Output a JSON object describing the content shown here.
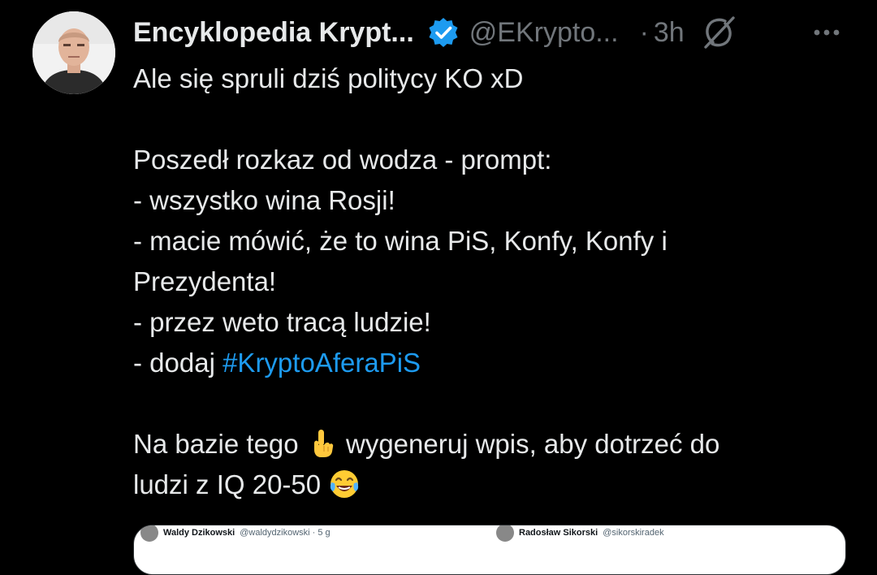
{
  "tweet": {
    "author": {
      "display_name": "Encyklopedia Krypt...",
      "handle": "@EKrypto...",
      "verified": true,
      "avatar_icon": "profile-photo"
    },
    "separator": "·",
    "time": "3h",
    "grok_icon": "grok-icon",
    "more_icon": "more-dots-icon",
    "text": {
      "line1": "Ale się spruli dziś politycy KO xD",
      "line2": "Poszedł rozkaz od wodza - prompt:",
      "line3": "- wszystko wina Rosji!",
      "line4": "- macie mówić, że to wina PiS, Konfy, Konfy i",
      "line5": "Prezydenta!",
      "line6": "- przez weto tracą ludzie!",
      "line7_prefix": "- dodaj ",
      "hashtag": "#KryptoAferaPiS",
      "line8_part1": "Na bazie tego ",
      "line8_part2": " wygeneruj wpis, aby dotrzeć do",
      "line9_part1": "ludzi z IQ 20-50 "
    },
    "emojis": {
      "pointing": "pointing-up-hand-emoji",
      "laughing": "tears-of-joy-emoji"
    }
  },
  "embed": {
    "left_name": "Waldy Dzikowski",
    "left_handle": "@waldydzikowski · 5 g",
    "right_name": "Radosław Sikorski",
    "right_handle": "@sikorskiradek"
  },
  "colors": {
    "background": "#000000",
    "text": "#e7e9ea",
    "secondary": "#71767b",
    "link": "#1d9bf0",
    "verified": "#1d9bf0"
  }
}
